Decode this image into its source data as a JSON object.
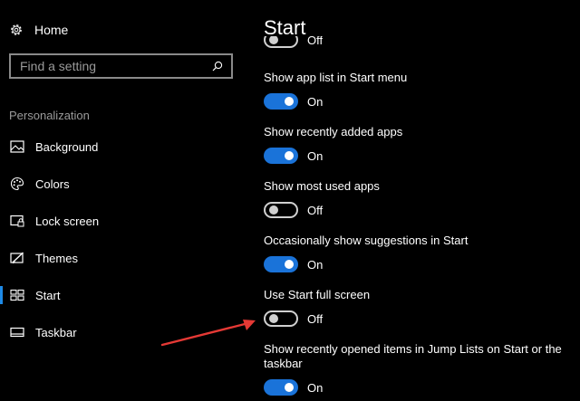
{
  "sidebar": {
    "home_label": "Home",
    "search_placeholder": "Find a setting",
    "section_label": "Personalization",
    "items": [
      {
        "label": "Background",
        "icon": "image-icon",
        "active": false
      },
      {
        "label": "Colors",
        "icon": "palette-icon",
        "active": false
      },
      {
        "label": "Lock screen",
        "icon": "lock-screen-icon",
        "active": false
      },
      {
        "label": "Themes",
        "icon": "themes-icon",
        "active": false
      },
      {
        "label": "Start",
        "icon": "start-icon",
        "active": true
      },
      {
        "label": "Taskbar",
        "icon": "taskbar-icon",
        "active": false
      }
    ]
  },
  "main": {
    "title": "Start",
    "partial_state": "Off",
    "settings": [
      {
        "title": "Show app list in Start menu",
        "on": true,
        "state": "On"
      },
      {
        "title": "Show recently added apps",
        "on": true,
        "state": "On"
      },
      {
        "title": "Show most used apps",
        "on": false,
        "state": "Off"
      },
      {
        "title": "Occasionally show suggestions in Start",
        "on": true,
        "state": "On"
      },
      {
        "title": "Use Start full screen",
        "on": false,
        "state": "Off"
      },
      {
        "title": "Show recently opened items in Jump Lists on Start or the taskbar",
        "on": true,
        "state": "On"
      }
    ]
  },
  "colors": {
    "accent": "#1a73d9",
    "annotation_arrow": "#e53935"
  }
}
